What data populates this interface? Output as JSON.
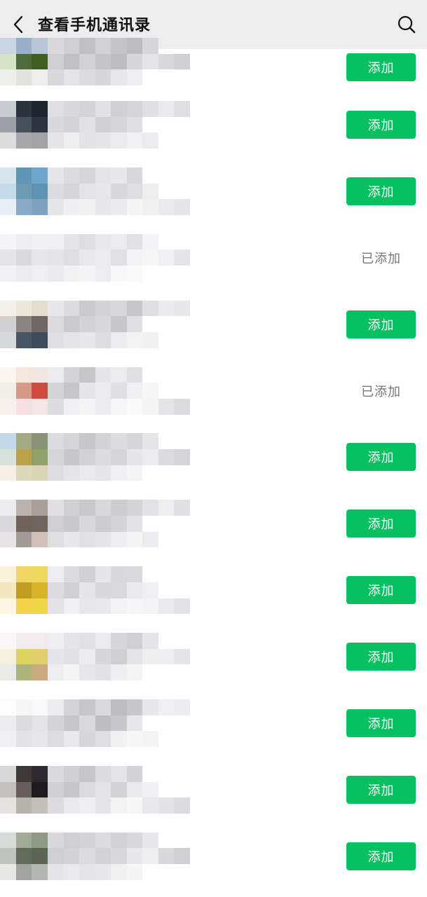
{
  "header": {
    "title": "查看手机通讯录",
    "back_icon": "chevron-left-icon",
    "search_icon": "search-icon"
  },
  "colors": {
    "accent": "#07c160",
    "header_bg": "#ededed",
    "added_text": "#777777"
  },
  "contacts": [
    {
      "status": "add",
      "label": "添加",
      "avatar": [
        "#c9d6e4",
        "#9ab0c8",
        "#b7c5d4",
        "#d8e2c7",
        "#4f6b3a",
        "#3f5e22",
        "#eef0ea",
        "#e1e4dc",
        "#eeeeee"
      ],
      "pixels": [
        "#d9d9dc",
        "#cfcfd3",
        "#bfbfc4",
        "#d2d2d6",
        "#c4c4c9",
        "#bcbcc1",
        "#d7d7da",
        "#e5e5e8"
      ]
    },
    {
      "status": "add",
      "label": "添加",
      "avatar": [
        "#c8cbcf",
        "#2b333d",
        "#1f252d",
        "#9aa0a6",
        "#45505c",
        "#2d3540",
        "#dcdcdc",
        "#a7a7a9",
        "#a2a2a4"
      ],
      "pixels": [
        "#dfdfe2",
        "#d9d9dc",
        "#d4d4d8",
        "#e2e2e5",
        "#d1d1d5",
        "#d6d6d9",
        "#e0e0e3",
        "#eaeaec"
      ]
    },
    {
      "status": "add",
      "label": "添加",
      "avatar": [
        "#d7e5ef",
        "#5f96b8",
        "#6fa6cc",
        "#c6dbe8",
        "#6e9ab3",
        "#5d93b3",
        "#e6eef3",
        "#8aa9c4",
        "#7fa2c0"
      ],
      "pixels": [
        "#e6e6e8",
        "#dcdce0",
        "#d6d6da",
        "#e4e4e7",
        "#e8e8ea",
        "#d8d8dc",
        "#dedee1",
        "#eeeeef"
      ]
    },
    {
      "status": "added",
      "label": "已添加",
      "avatar": [
        "#f4f4f6",
        "#eeeef0",
        "#f1f1f3",
        "#e5e5e8",
        "#dadadd",
        "#e7e7ea",
        "#f2f2f4",
        "#ececee",
        "#f0f0f2"
      ],
      "pixels": [
        "#f0f0f2",
        "#e5e5e8",
        "#dedee1",
        "#e9e9eb",
        "#ececee",
        "#e1e1e4",
        "#f3f3f5",
        "#f6f6f7"
      ]
    },
    {
      "status": "add",
      "label": "添加",
      "avatar": [
        "#f4f1ea",
        "#ece7da",
        "#e1ddcf",
        "#d1d1d1",
        "#8a8580",
        "#6d6863",
        "#d7d8da",
        "#485564",
        "#3f4b58"
      ],
      "pixels": [
        "#e8e8ea",
        "#dcdcdf",
        "#cacacf",
        "#d3d3d7",
        "#d8d8dc",
        "#c6c6cb",
        "#e0e0e3",
        "#ebebed"
      ]
    },
    {
      "status": "added",
      "label": "已添加",
      "avatar": [
        "#fbf6f2",
        "#f6e6de",
        "#efe7e2",
        "#f2efe8",
        "#d59b86",
        "#d04b3f",
        "#f7f1ee",
        "#f5e1e5",
        "#f4e6e8"
      ],
      "pixels": [
        "#ececef",
        "#d4d4d8",
        "#c5c5ca",
        "#e6e6e9",
        "#ececee",
        "#e0e0e3",
        "#f0f0f2",
        "#f6f6f7"
      ]
    },
    {
      "status": "add",
      "label": "添加",
      "avatar": [
        "#c3d9ea",
        "#a3aa84",
        "#8a9278",
        "#d6e1da",
        "#b9a24a",
        "#92a06a",
        "#f6efe3",
        "#ddd8bb",
        "#dad5b4"
      ],
      "pixels": [
        "#dcdcdf",
        "#d5d5d9",
        "#c7c7cc",
        "#d3d3d7",
        "#dcdce0",
        "#d6d6da",
        "#e6e6e9",
        "#ececee"
      ]
    },
    {
      "status": "add",
      "label": "添加",
      "avatar": [
        "#ecebee",
        "#bbb2ad",
        "#a89f98",
        "#d9d9dc",
        "#6f625b",
        "#70655e",
        "#e5e3e4",
        "#a39b97",
        "#d3c0b8"
      ],
      "pixels": [
        "#e0e0e3",
        "#cfcfd3",
        "#c8c8cd",
        "#d9d9dc",
        "#cdcdd1",
        "#d4d4d8",
        "#e3e3e6",
        "#eeeeef"
      ]
    },
    {
      "status": "add",
      "label": "添加",
      "avatar": [
        "#fbf3d9",
        "#f0d666",
        "#efd85e",
        "#f3e7bd",
        "#c09d22",
        "#d9b32a",
        "#fcf6e2",
        "#f3d34c",
        "#efd548"
      ],
      "pixels": [
        "#ededef",
        "#dcdce0",
        "#d1d1d5",
        "#e6e6e9",
        "#d9d9dc",
        "#dadadd",
        "#ebebed",
        "#f0f0f2"
      ]
    },
    {
      "status": "add",
      "label": "添加",
      "avatar": [
        "#faf7f5",
        "#f0ecea",
        "#f1ebe9",
        "#f4f1e0",
        "#ddd55f",
        "#e0cf6a",
        "#e9ece6",
        "#adb57e",
        "#c9a97d"
      ],
      "pixels": [
        "#efeff1",
        "#e5e5e8",
        "#e1e1e4",
        "#ececee",
        "#d7d7da",
        "#cfcfd3",
        "#e5e5e8",
        "#eeeeef"
      ]
    },
    {
      "status": "add",
      "label": "添加",
      "avatar": [
        "#fcfcfd",
        "#f6f6f7",
        "#f9f9fa",
        "#ececef",
        "#dcdcdf",
        "#e4e4e7",
        "#f0f0f2",
        "#e3e3e6",
        "#e7e7ea"
      ],
      "pixels": [
        "#ececee",
        "#d4d4d8",
        "#c6c6cb",
        "#dadadd",
        "#bdbdc2",
        "#c8c8cc",
        "#e7e7ea",
        "#f0f0f2"
      ]
    },
    {
      "status": "add",
      "label": "添加",
      "avatar": [
        "#d9d8d8",
        "#3e3937",
        "#2c2a30",
        "#c2bfbf",
        "#675e5b",
        "#1c1a1c",
        "#e4e3e0",
        "#b6b3ad",
        "#c2bfb9"
      ],
      "pixels": [
        "#dadadd",
        "#d0d0d4",
        "#c5c5ca",
        "#dcdce0",
        "#e4e4e7",
        "#d3d3d7",
        "#ebebed",
        "#f1f1f3"
      ]
    },
    {
      "status": "add",
      "label": "添加",
      "avatar": [
        "#d7dcd8",
        "#a1a997",
        "#8f9a85",
        "#bfc4c0",
        "#626a5b",
        "#5d6456",
        "#e7e7e6",
        "#a1a3a0",
        "#b4b6b3"
      ],
      "pixels": [
        "#d9d9dc",
        "#cfcfd3",
        "#d3d3d7",
        "#dcdce0",
        "#d2d2d6",
        "#d8d8dc",
        "#e8e8ea",
        "#eeeeef"
      ]
    }
  ]
}
